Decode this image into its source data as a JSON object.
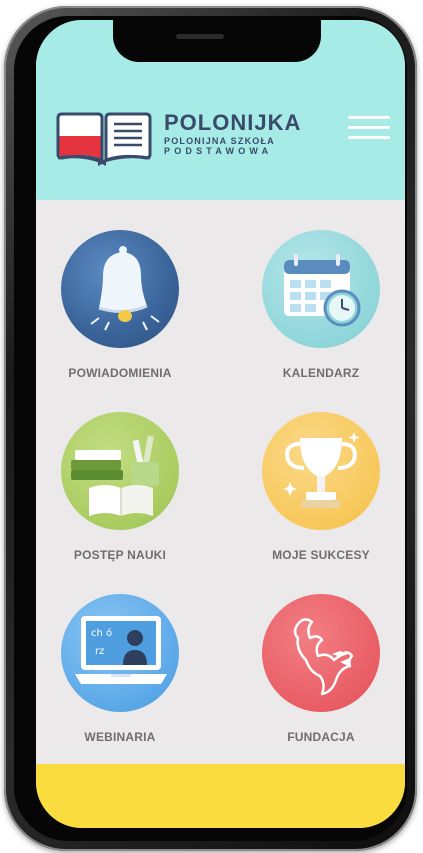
{
  "app": {
    "title": "POLONIJKA",
    "subtitle_line1": "POLONIJNA SZKOŁA",
    "subtitle_line2": "PODSTAWOWA"
  },
  "header": {
    "logo_icon": "book-flag-logo",
    "menu_icon": "hamburger-menu-icon"
  },
  "tiles": [
    {
      "label": "POWIADOMIENIA",
      "icon": "bell-icon",
      "color": "#3f6da3"
    },
    {
      "label": "KALENDARZ",
      "icon": "calendar-clock-icon",
      "color": "#8fd6da"
    },
    {
      "label": "POSTĘP NAUKI",
      "icon": "books-icon",
      "color": "#a9cc60"
    },
    {
      "label": "MOJE SUKCESY",
      "icon": "trophy-icon",
      "color": "#f7c85a"
    },
    {
      "label": "WEBINARIA",
      "icon": "laptop-teacher-icon",
      "color": "#5aa8e8"
    },
    {
      "label": "FUNDACJA",
      "icon": "eagle-icon",
      "color": "#e95d64"
    }
  ],
  "colors": {
    "header_bg": "#a6ebe5",
    "content_bg": "#ece9ea",
    "footer_bg": "#fadc3f",
    "brand_text": "#3a4a6b"
  }
}
